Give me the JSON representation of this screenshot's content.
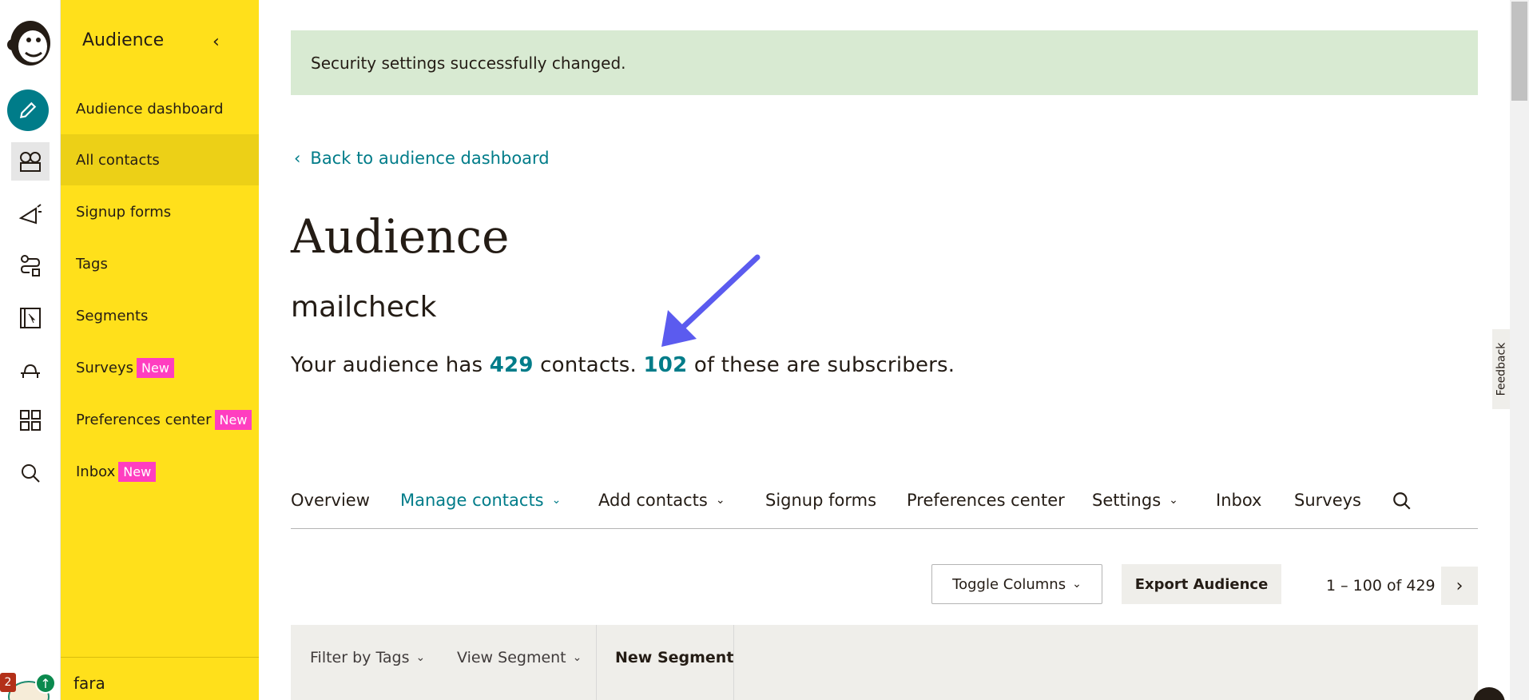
{
  "subnav": {
    "title": "Audience",
    "items": [
      {
        "label": "Audience dashboard",
        "is_new": false
      },
      {
        "label": "All contacts",
        "is_new": false
      },
      {
        "label": "Signup forms",
        "is_new": false
      },
      {
        "label": "Tags",
        "is_new": false
      },
      {
        "label": "Segments",
        "is_new": false
      },
      {
        "label": "Surveys",
        "is_new": true
      },
      {
        "label": "Preferences center",
        "is_new": true
      },
      {
        "label": "Inbox",
        "is_new": true
      }
    ],
    "new_label": "New",
    "account": "fara",
    "notification_count": "2"
  },
  "alert": {
    "message": "Security settings successfully changed."
  },
  "back_link": "Back to audience dashboard",
  "page_title": "Audience",
  "audience_name": "mailcheck",
  "summary": {
    "prefix": "Your audience has",
    "contacts": "429",
    "middle": "contacts.",
    "subscribers": "102",
    "suffix": "of these are subscribers."
  },
  "tabs": [
    {
      "label": "Overview",
      "dropdown": false
    },
    {
      "label": "Manage contacts",
      "dropdown": true
    },
    {
      "label": "Add contacts",
      "dropdown": true
    },
    {
      "label": "Signup forms",
      "dropdown": false
    },
    {
      "label": "Preferences center",
      "dropdown": false
    },
    {
      "label": "Settings",
      "dropdown": true
    },
    {
      "label": "Inbox",
      "dropdown": false
    },
    {
      "label": "Surveys",
      "dropdown": false
    }
  ],
  "toolbar": {
    "toggle_columns": "Toggle Columns",
    "export": "Export Audience",
    "pager_range": "1 – 100",
    "pager_of": "of",
    "pager_total": "429"
  },
  "filters": {
    "tags": "Filter by Tags",
    "segment": "View Segment",
    "new_segment": "New Segment"
  },
  "feedback": "Feedback",
  "colors": {
    "accent": "#007c89",
    "nav_yellow": "#ffe01b",
    "new_badge": "#ff3ec0",
    "alert_bg": "#d8ead2"
  }
}
